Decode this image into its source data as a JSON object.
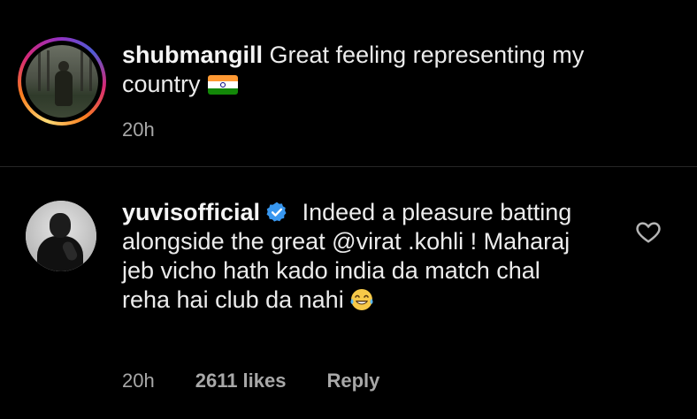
{
  "post": {
    "username": "shubmangill",
    "caption": "Great feeling representing my country",
    "flag_emoji": "india-flag",
    "time": "20h"
  },
  "comment": {
    "username": "yuvisofficial",
    "verified": true,
    "text": "Indeed a pleasure batting alongside the great @virat .kohli ! Maharaj jeb vicho hath kado india da match chal reha hai club da nahi",
    "emoji": "tears-of-joy-emoji",
    "time": "20h",
    "likes": "2611 likes",
    "reply_label": "Reply",
    "like_icon": "heart-outline-icon"
  },
  "colors": {
    "background": "#000000",
    "primary_text": "#f5f5f5",
    "secondary_text": "#a8a8a8",
    "verified_blue": "#3897f0",
    "divider": "#262626"
  }
}
